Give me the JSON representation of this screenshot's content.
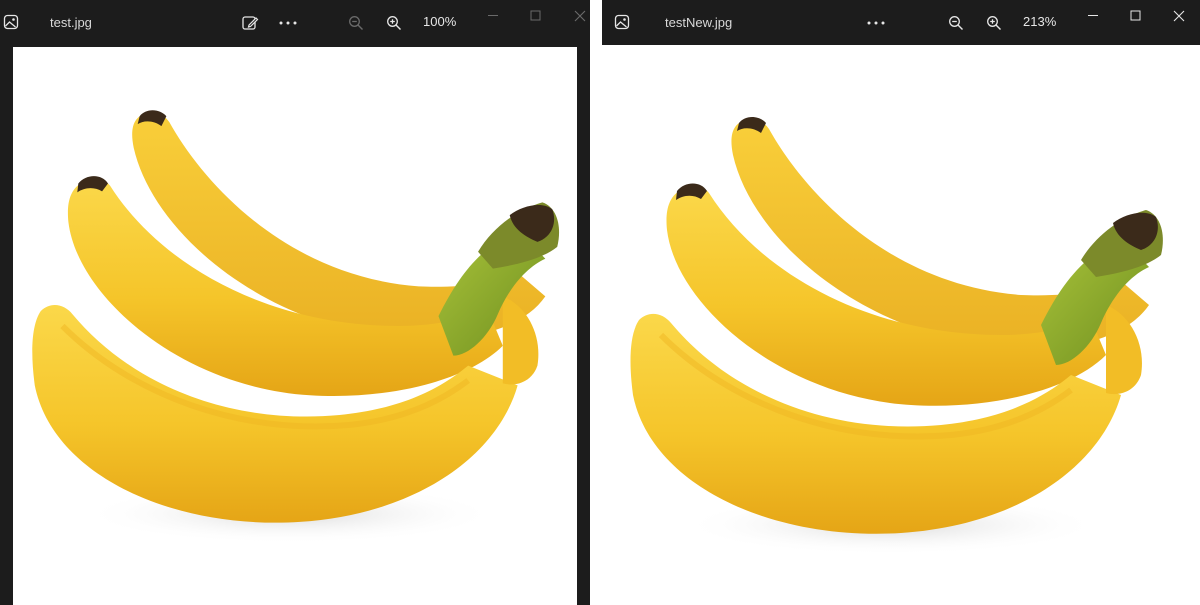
{
  "colors": {
    "titlebar": "#1c1c1c",
    "canvas": "#ffffff",
    "banana": "#f5c52a",
    "banana_shade": "#e8a81c",
    "stem": "#8fb02c",
    "tip": "#3b2a1a"
  },
  "windows": [
    {
      "file_name": "test.jpg",
      "zoom_label": "100%",
      "toolbar": [
        "app-photo-icon",
        "edit-image-icon",
        "more-icon",
        "zoom-out-icon",
        "zoom-in-icon"
      ],
      "zoom_out_enabled": false
    },
    {
      "file_name": "testNew.jpg",
      "zoom_label": "213%",
      "toolbar": [
        "app-photo-icon",
        "more-icon",
        "zoom-out-icon",
        "zoom-in-icon"
      ],
      "zoom_out_enabled": true
    }
  ],
  "image_subject": "bananas-photo"
}
